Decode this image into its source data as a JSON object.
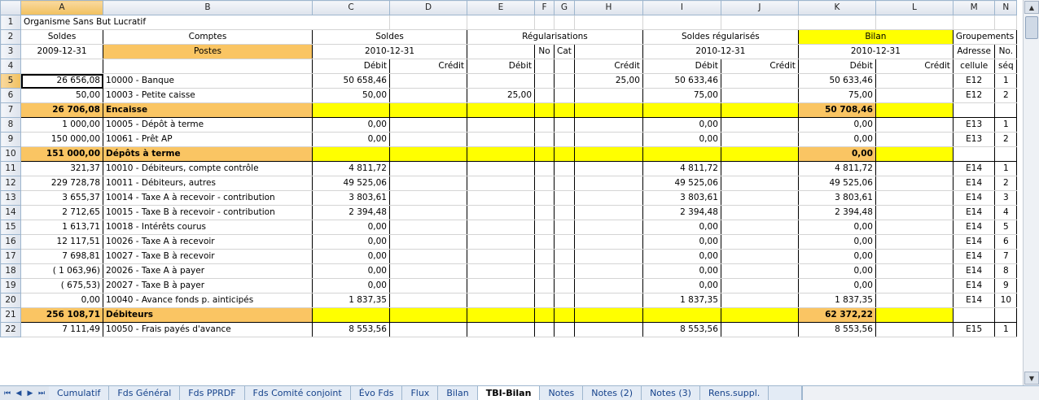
{
  "columns": [
    "A",
    "B",
    "C",
    "D",
    "E",
    "F",
    "G",
    "H",
    "I",
    "J",
    "K",
    "L",
    "M",
    "N"
  ],
  "header": {
    "r1": "Organisme Sans But Lucratif",
    "r2": {
      "a": "Soldes",
      "b": "Comptes",
      "cd": "Soldes",
      "eh": "Régularisations",
      "ij": "Soldes régularisés",
      "kl": "Bilan",
      "mn": "Groupements"
    },
    "r3": {
      "a": "2009-12-31",
      "b": "Postes",
      "cd": "2010-12-31",
      "f": "No",
      "g": "Cat",
      "ij": "2010-12-31",
      "kl": "2010-12-31",
      "m": "Adresse",
      "n": "No."
    },
    "r4": {
      "c": "Débit",
      "d": "Crédit",
      "e": "Débit",
      "h": "Crédit",
      "i": "Débit",
      "j": "Crédit",
      "k": "Débit",
      "l": "Crédit",
      "m": "cellule",
      "n": "séq"
    }
  },
  "rows": [
    {
      "n": "5",
      "a": "26 656,08",
      "b": "10000 - Banque",
      "c": "50 658,46",
      "d": "",
      "e": "",
      "h": "25,00",
      "i": "50 633,46",
      "j": "",
      "k": "50 633,46",
      "l": "",
      "m": "E12",
      "s": "1"
    },
    {
      "n": "6",
      "a": "50,00",
      "b": "10003 - Petite caisse",
      "c": "50,00",
      "d": "",
      "e": "25,00",
      "h": "",
      "i": "75,00",
      "j": "",
      "k": "75,00",
      "l": "",
      "m": "E12",
      "s": "2"
    },
    {
      "n": "7",
      "sub": true,
      "a": "26 706,08",
      "b": "Encaisse",
      "k": "50 708,46"
    },
    {
      "n": "8",
      "a": "1 000,00",
      "b": "10005 - Dépôt à terme",
      "c": "0,00",
      "d": "",
      "e": "",
      "h": "",
      "i": "0,00",
      "j": "",
      "k": "0,00",
      "l": "",
      "m": "E13",
      "s": "1"
    },
    {
      "n": "9",
      "a": "150 000,00",
      "b": "10061 - Prêt AP",
      "c": "0,00",
      "d": "",
      "e": "",
      "h": "",
      "i": "0,00",
      "j": "",
      "k": "0,00",
      "l": "",
      "m": "E13",
      "s": "2"
    },
    {
      "n": "10",
      "sub": true,
      "a": "151 000,00",
      "b": "Dépôts à terme",
      "k": "0,00"
    },
    {
      "n": "11",
      "a": "321,37",
      "b": "10010 - Débiteurs, compte contrôle",
      "c": "4 811,72",
      "d": "",
      "e": "",
      "h": "",
      "i": "4 811,72",
      "j": "",
      "k": "4 811,72",
      "l": "",
      "m": "E14",
      "s": "1"
    },
    {
      "n": "12",
      "a": "229 728,78",
      "b": "10011 - Débiteurs, autres",
      "c": "49 525,06",
      "d": "",
      "e": "",
      "h": "",
      "i": "49 525,06",
      "j": "",
      "k": "49 525,06",
      "l": "",
      "m": "E14",
      "s": "2"
    },
    {
      "n": "13",
      "a": "3 655,37",
      "b": "10014 - Taxe A à recevoir - contribution",
      "c": "3 803,61",
      "d": "",
      "e": "",
      "h": "",
      "i": "3 803,61",
      "j": "",
      "k": "3 803,61",
      "l": "",
      "m": "E14",
      "s": "3"
    },
    {
      "n": "14",
      "a": "2 712,65",
      "b": "10015 - Taxe B à recevoir - contribution",
      "c": "2 394,48",
      "d": "",
      "e": "",
      "h": "",
      "i": "2 394,48",
      "j": "",
      "k": "2 394,48",
      "l": "",
      "m": "E14",
      "s": "4"
    },
    {
      "n": "15",
      "a": "1 613,71",
      "b": "10018 - Intérêts courus",
      "c": "0,00",
      "d": "",
      "e": "",
      "h": "",
      "i": "0,00",
      "j": "",
      "k": "0,00",
      "l": "",
      "m": "E14",
      "s": "5"
    },
    {
      "n": "16",
      "a": "12 117,51",
      "b": "10026 - Taxe A à recevoir",
      "c": "0,00",
      "d": "",
      "e": "",
      "h": "",
      "i": "0,00",
      "j": "",
      "k": "0,00",
      "l": "",
      "m": "E14",
      "s": "6"
    },
    {
      "n": "17",
      "a": "7 698,81",
      "b": "10027 - Taxe B à recevoir",
      "c": "0,00",
      "d": "",
      "e": "",
      "h": "",
      "i": "0,00",
      "j": "",
      "k": "0,00",
      "l": "",
      "m": "E14",
      "s": "7"
    },
    {
      "n": "18",
      "a": "(      1 063,96)",
      "b": "20026 - Taxe A à payer",
      "c": "0,00",
      "d": "",
      "e": "",
      "h": "",
      "i": "0,00",
      "j": "",
      "k": "0,00",
      "l": "",
      "m": "E14",
      "s": "8"
    },
    {
      "n": "19",
      "a": "(         675,53)",
      "b": "20027 - Taxe B à payer",
      "c": "0,00",
      "d": "",
      "e": "",
      "h": "",
      "i": "0,00",
      "j": "",
      "k": "0,00",
      "l": "",
      "m": "E14",
      "s": "9"
    },
    {
      "n": "20",
      "a": "0,00",
      "b": "10040 - Avance fonds p. ainticipés",
      "c": "1 837,35",
      "d": "",
      "e": "",
      "h": "",
      "i": "1 837,35",
      "j": "",
      "k": "1 837,35",
      "l": "",
      "m": "E14",
      "s": "10"
    },
    {
      "n": "21",
      "sub": true,
      "a": "256 108,71",
      "b": "Débiteurs",
      "k": "62 372,22"
    },
    {
      "n": "22",
      "a": "7 111,49",
      "b": "10050 - Frais payés d'avance",
      "c": "8 553,56",
      "d": "",
      "e": "",
      "h": "",
      "i": "8 553,56",
      "j": "",
      "k": "8 553,56",
      "l": "",
      "m": "E15",
      "s": "1"
    }
  ],
  "sheet_tabs": [
    "Cumulatif",
    "Fds Général",
    "Fds PPRDF",
    "Fds Comité conjoint",
    "Évo Fds",
    "Flux",
    "Bilan",
    "TBI-Bilan",
    "Notes",
    "Notes (2)",
    "Notes (3)",
    "Rens.suppl."
  ],
  "active_tab": "TBI-Bilan",
  "nav_glyphs": [
    "⏮",
    "◀",
    "▶",
    "⏭"
  ],
  "colors": {
    "yellow": "#ffff00",
    "orange": "#fac563",
    "selected_header": "#f1c15f"
  }
}
